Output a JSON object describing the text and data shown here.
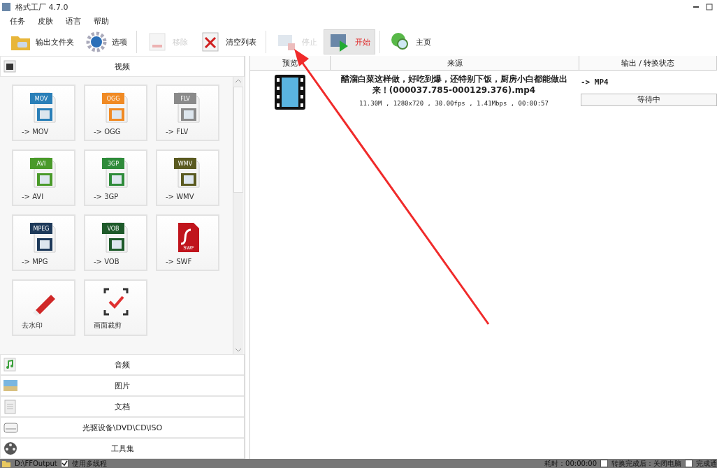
{
  "window": {
    "title": "格式工厂 4.7.0"
  },
  "menu": [
    {
      "label": "任务"
    },
    {
      "label": "皮肤"
    },
    {
      "label": "语言"
    },
    {
      "label": "帮助"
    }
  ],
  "toolbar": [
    {
      "label": "输出文件夹",
      "kind": "folder",
      "disabled": false,
      "highlighted": false
    },
    {
      "label": "选项",
      "kind": "gear",
      "disabled": false,
      "highlighted": false
    },
    {
      "label": "移除",
      "kind": "remove",
      "disabled": true,
      "highlighted": false
    },
    {
      "label": "清空列表",
      "kind": "clear",
      "disabled": false,
      "highlighted": false
    },
    {
      "label": "停止",
      "kind": "stop",
      "disabled": true,
      "highlighted": false
    },
    {
      "label": "开始",
      "kind": "start",
      "disabled": false,
      "highlighted": true
    },
    {
      "label": "主页",
      "kind": "home",
      "disabled": false,
      "highlighted": false
    }
  ],
  "sidebar": {
    "open_section": {
      "label": "视频",
      "kind": "video"
    },
    "tiles": [
      {
        "label": "-> MOV",
        "badge": "MOV",
        "color": "#2a7fb8",
        "kind": "file"
      },
      {
        "label": "-> OGG",
        "badge": "OGG",
        "color": "#f08a24",
        "kind": "file"
      },
      {
        "label": "-> FLV",
        "badge": "FLV",
        "color": "#8a8a8a",
        "kind": "file"
      },
      {
        "label": "-> AVI",
        "badge": "AVI",
        "color": "#4a9a2a",
        "kind": "file"
      },
      {
        "label": "-> 3GP",
        "badge": "3GP",
        "color": "#2e8b3a",
        "kind": "file"
      },
      {
        "label": "-> WMV",
        "badge": "WMV",
        "color": "#5a5a20",
        "kind": "file"
      },
      {
        "label": "-> MPG",
        "badge": "MPEG",
        "color": "#1e3a5a",
        "kind": "file"
      },
      {
        "label": "-> VOB",
        "badge": "VOB",
        "color": "#1e5a2a",
        "kind": "file"
      },
      {
        "label": "-> SWF",
        "badge": "SWF",
        "color": "#c0141c",
        "kind": "swf"
      },
      {
        "label": "去水印",
        "kind": "eraser"
      },
      {
        "label": "画面裁剪",
        "kind": "crop"
      }
    ],
    "sections": [
      {
        "label": "音频",
        "kind": "audio"
      },
      {
        "label": "图片",
        "kind": "image"
      },
      {
        "label": "文档",
        "kind": "doc"
      },
      {
        "label": "光驱设备\\DVD\\CD\\ISO",
        "kind": "disc"
      },
      {
        "label": "工具集",
        "kind": "tools"
      }
    ]
  },
  "table": {
    "columns": [
      "预览",
      "来源",
      "输出 / 转换状态"
    ],
    "rows": [
      {
        "title": "醋溜白菜这样做，好吃到爆，还特别下饭，厨房小白都能做出来！(000037.785-000129.376).mp4",
        "info": "11.30M , 1280x720 , 30.00fps , 1.41Mbps , 00:00:57",
        "output": "-> MP4",
        "status": "等待中"
      }
    ]
  },
  "status_bar": {
    "folder": "D:\\FFOutput",
    "multithread": {
      "label": "使用多线程",
      "checked": true
    },
    "elapsed": "耗时：00:00:00",
    "shutdown": {
      "label": "转换完成后：关闭电脑",
      "checked": false
    },
    "notify": {
      "label": "完成通",
      "checked": false
    }
  }
}
